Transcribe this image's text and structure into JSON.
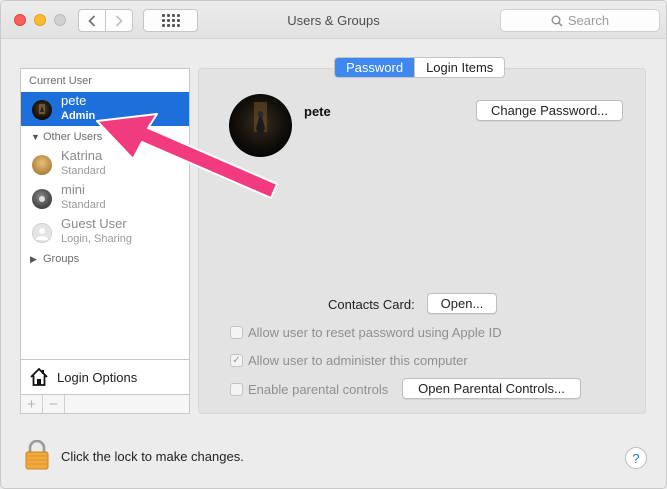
{
  "window": {
    "title": "Users & Groups",
    "search_placeholder": "Search"
  },
  "sidebar": {
    "current_user_heading": "Current User",
    "current_user": {
      "name": "pete",
      "role": "Admin"
    },
    "other_users_heading": "Other Users",
    "other_users": [
      {
        "name": "Katrina",
        "role": "Standard"
      },
      {
        "name": "mini",
        "role": "Standard"
      },
      {
        "name": "Guest User",
        "role": "Login, Sharing"
      }
    ],
    "groups_label": "Groups",
    "login_options_label": "Login Options",
    "add_symbol": "+",
    "remove_symbol": "−"
  },
  "tabs": [
    {
      "label": "Password",
      "active": true
    },
    {
      "label": "Login Items",
      "active": false
    }
  ],
  "account": {
    "name": "pete",
    "change_password_label": "Change Password...",
    "contacts_card_label": "Contacts Card:",
    "open_label": "Open...",
    "checkboxes": [
      {
        "label": "Allow user to reset password using Apple ID",
        "checked": false
      },
      {
        "label": "Allow user to administer this computer",
        "checked": true
      },
      {
        "label": "Enable parental controls",
        "checked": false
      }
    ],
    "open_parental_controls_label": "Open Parental Controls..."
  },
  "footer": {
    "lock_text": "Click the lock to make changes.",
    "help_symbol": "?"
  },
  "colors": {
    "selection": "#1d6fdb",
    "tab_active": "#3f88ef",
    "annotation_arrow": "#f23b7e",
    "close": "#fc5f57",
    "minimize": "#fdbc2e"
  },
  "icons": [
    "back-chevron-icon",
    "forward-chevron-icon",
    "show-all-grid-icon",
    "search-icon",
    "house-icon",
    "lock-icon",
    "help-icon",
    "disclosure-triangle-icon"
  ]
}
